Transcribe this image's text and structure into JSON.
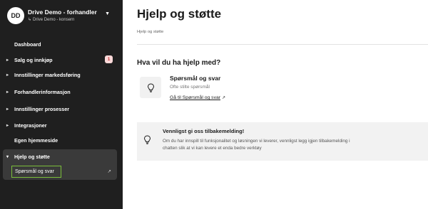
{
  "org": {
    "initials": "DD",
    "name": "Drive Demo - forhandler",
    "subtitle_arrow": "↳",
    "subtitle": "Drive Demo - konsern"
  },
  "sidebar": {
    "items": [
      {
        "label": "Dashboard"
      },
      {
        "label": "Salg og innkjøp",
        "badge": "1"
      },
      {
        "label": "Innstillinger markedsføring"
      },
      {
        "label": "Forhandlerinformasjon"
      },
      {
        "label": "Innstillinger prosesser"
      },
      {
        "label": "Integrasjoner"
      },
      {
        "label": "Egen hjemmeside"
      }
    ],
    "expanded": {
      "label": "Hjelp og støtte",
      "subitem": "Spørsmål og svar"
    },
    "chevron_right": "▸",
    "chevron_down": "▾",
    "external_glyph": "↗"
  },
  "main": {
    "title": "Hjelp og støtte",
    "breadcrumb": "Hjelp og støtte",
    "help_heading": "Hva vil du ha hjelp med?",
    "card": {
      "title": "Spørsmål og svar",
      "subtitle": "Ofte stilte spørsmål",
      "link": "Gå til Spørsmål og svar",
      "link_icon": "↗",
      "icon": "lightbulb-icon"
    },
    "feedback": {
      "title": "Vennligst gi oss tilbakemelding!",
      "text": "Om du har innspill til funksjonalitet og løsningen vi leverer, vennligst legg igjen tilbakemelding i chatten slik at vi kan levere et enda bedre verktøy",
      "icon": "lightbulb-icon"
    }
  },
  "colors": {
    "sidebar_bg": "#1f1f1f",
    "active_group_bg": "#3a3a3a",
    "active_outline": "#7bbf3a",
    "badge_bg": "#fcd9d9",
    "badge_text": "#c23030"
  }
}
